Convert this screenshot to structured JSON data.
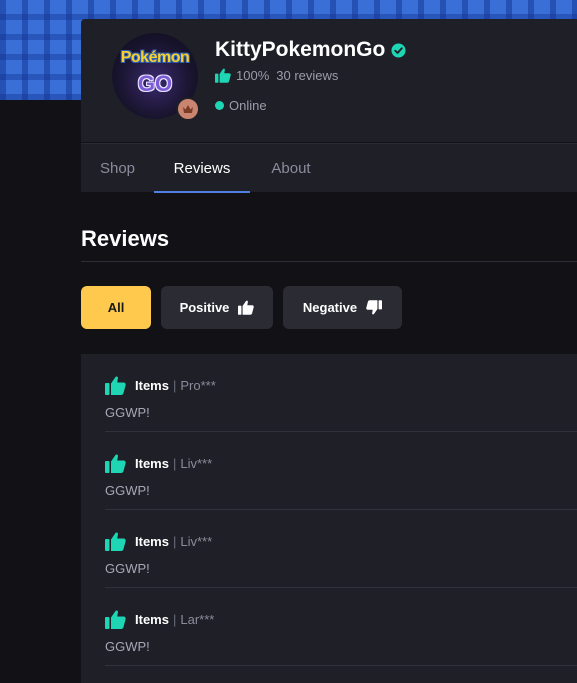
{
  "seller": {
    "name": "KittyPokemonGo",
    "rating_percent": "100%",
    "reviews_count": "30 reviews",
    "status": "Online",
    "avatar_logo_top": "Pokémon",
    "avatar_logo_bottom": "GO"
  },
  "tabs": [
    {
      "label": "Shop"
    },
    {
      "label": "Reviews"
    },
    {
      "label": "About"
    }
  ],
  "active_tab": "Reviews",
  "section_title": "Reviews",
  "filters": {
    "all": "All",
    "positive": "Positive",
    "negative": "Negative",
    "selected": "All"
  },
  "reviews": [
    {
      "category": "Items",
      "user": "Pro***",
      "text": "GGWP!",
      "sentiment": "positive"
    },
    {
      "category": "Items",
      "user": "Liv***",
      "text": "GGWP!",
      "sentiment": "positive"
    },
    {
      "category": "Items",
      "user": "Liv***",
      "text": "GGWP!",
      "sentiment": "positive"
    },
    {
      "category": "Items",
      "user": "Lar***",
      "text": "GGWP!",
      "sentiment": "positive"
    }
  ],
  "colors": {
    "accent_teal": "#1ed6b4",
    "filter_active": "#ffc94d",
    "tab_underline": "#4f7fe0",
    "banner": "#3a6fd8"
  }
}
